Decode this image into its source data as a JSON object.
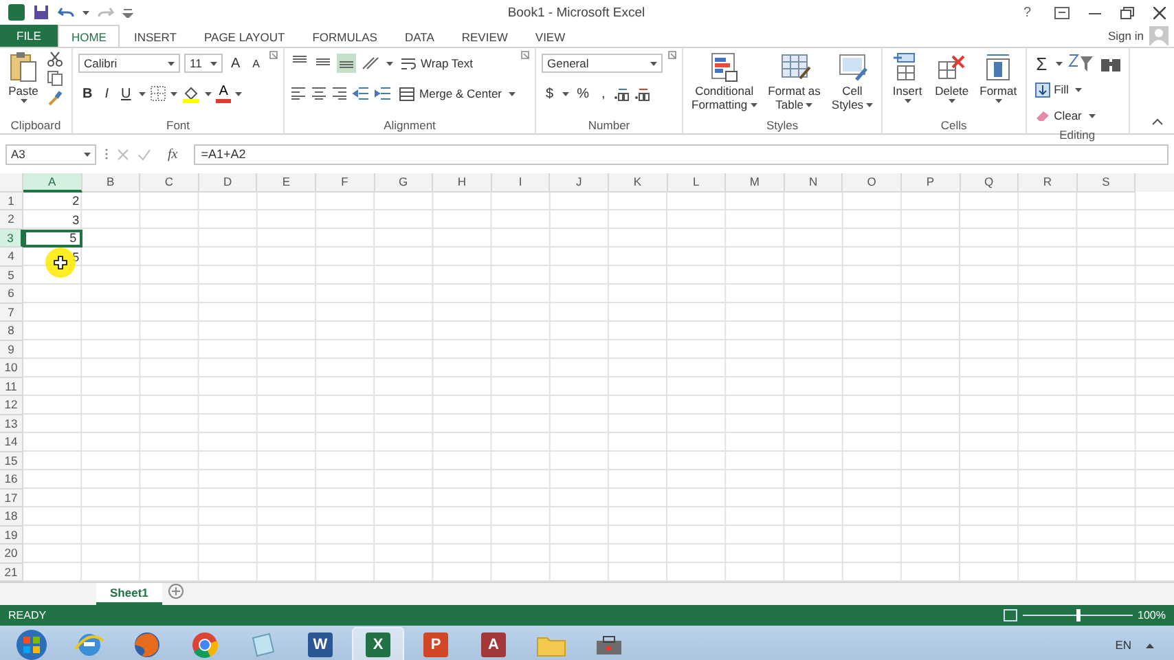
{
  "title_bar": {
    "title": "Book1 - Microsoft Excel",
    "help": "?"
  },
  "file_tab": {
    "label": "FILE"
  },
  "ribbon_tabs": [
    {
      "label": "HOME",
      "selected": true
    },
    {
      "label": "INSERT",
      "selected": false
    },
    {
      "label": "PAGE LAYOUT",
      "selected": false
    },
    {
      "label": "FORMULAS",
      "selected": false
    },
    {
      "label": "DATA",
      "selected": false
    },
    {
      "label": "REVIEW",
      "selected": false
    },
    {
      "label": "VIEW",
      "selected": false
    }
  ],
  "account": {
    "label": "Sign in"
  },
  "ribbon_groups": [
    {
      "kind": "clipboard",
      "label": "Clipboard",
      "paste": "Paste"
    },
    {
      "kind": "font",
      "label": "Font",
      "font": "Calibri",
      "size": "11",
      "grow": "A",
      "shrink": "A",
      "bold": "B",
      "italic": "I",
      "underline": "U",
      "font_color": "A"
    },
    {
      "kind": "alignment",
      "label": "Alignment",
      "vertical_align": [
        {
          "selected": false
        },
        {
          "selected": false
        },
        {
          "selected": true
        }
      ],
      "wrap": "Wrap Text",
      "merge": "Merge & Center"
    },
    {
      "kind": "number",
      "label": "Number",
      "format": "General",
      "currency": "$",
      "percent": "%",
      "comma": ","
    },
    {
      "kind": "styles",
      "label": "Styles",
      "buttons": [
        {
          "lines": [
            "Conditional",
            "Formatting"
          ]
        },
        {
          "lines": [
            "Format as",
            "Table"
          ]
        },
        {
          "lines": [
            "Cell",
            "Styles"
          ]
        }
      ]
    },
    {
      "kind": "cells",
      "label": "Cells",
      "buttons": [
        {
          "lines": [
            "Insert"
          ]
        },
        {
          "lines": [
            "Delete"
          ]
        },
        {
          "lines": [
            "Format"
          ]
        }
      ]
    },
    {
      "kind": "editing",
      "label": "Editing",
      "sum": "Σ",
      "fill": "Fill",
      "clear": "Clear"
    }
  ],
  "formula_bar": {
    "name_box": "A3",
    "function_label": "fx",
    "formula": "=A1+A2"
  },
  "sheet": {
    "columns": [
      {
        "label": "A",
        "selected": true
      },
      {
        "label": "B",
        "selected": false
      },
      {
        "label": "C",
        "selected": false
      },
      {
        "label": "D",
        "selected": false
      },
      {
        "label": "E",
        "selected": false
      },
      {
        "label": "F",
        "selected": false
      },
      {
        "label": "G",
        "selected": false
      },
      {
        "label": "H",
        "selected": false
      },
      {
        "label": "I",
        "selected": false
      },
      {
        "label": "J",
        "selected": false
      },
      {
        "label": "K",
        "selected": false
      },
      {
        "label": "L",
        "selected": false
      },
      {
        "label": "M",
        "selected": false
      },
      {
        "label": "N",
        "selected": false
      },
      {
        "label": "O",
        "selected": false
      },
      {
        "label": "P",
        "selected": false
      },
      {
        "label": "Q",
        "selected": false
      },
      {
        "label": "R",
        "selected": false
      },
      {
        "label": "S",
        "selected": false
      }
    ],
    "rows": [
      {
        "number": "1",
        "selected": false,
        "cells": [
          {
            "value": "2",
            "selected": false
          }
        ]
      },
      {
        "number": "2",
        "selected": false,
        "cells": [
          {
            "value": "3",
            "selected": false
          }
        ]
      },
      {
        "number": "3",
        "selected": true,
        "cells": [
          {
            "value": "5",
            "selected": true
          }
        ]
      },
      {
        "number": "4",
        "selected": false,
        "cells": [
          {
            "value": "5",
            "selected": false
          }
        ]
      },
      {
        "number": "5",
        "selected": false
      },
      {
        "number": "6",
        "selected": false
      },
      {
        "number": "7",
        "selected": false
      },
      {
        "number": "8",
        "selected": false
      },
      {
        "number": "9",
        "selected": false
      },
      {
        "number": "10",
        "selected": false
      },
      {
        "number": "11",
        "selected": false
      },
      {
        "number": "12",
        "selected": false
      },
      {
        "number": "13",
        "selected": false
      },
      {
        "number": "14",
        "selected": false
      },
      {
        "number": "15",
        "selected": false
      },
      {
        "number": "16",
        "selected": false
      },
      {
        "number": "17",
        "selected": false
      },
      {
        "number": "18",
        "selected": false
      },
      {
        "number": "19",
        "selected": false
      },
      {
        "number": "20",
        "selected": false
      },
      {
        "number": "21",
        "selected": false
      }
    ]
  },
  "sheet_tabs": [
    {
      "label": "Sheet1",
      "selected": true
    }
  ],
  "status_bar": {
    "mode": "READY",
    "zoom": "100%",
    "level": 0.5
  },
  "taskbar": {
    "apps": [
      {
        "kind": "start",
        "selected": false
      },
      {
        "kind": "browser-e",
        "selected": false
      },
      {
        "kind": "browser-fox",
        "selected": false
      },
      {
        "kind": "browser-chrome",
        "selected": false
      },
      {
        "kind": "notepad",
        "selected": false
      },
      {
        "kind": "office",
        "letter": "W",
        "color": "#2b5797",
        "selected": false
      },
      {
        "kind": "office",
        "letter": "X",
        "color": "#217346",
        "selected": true
      },
      {
        "kind": "office",
        "letter": "P",
        "color": "#d24726",
        "selected": false
      },
      {
        "kind": "office",
        "letter": "A",
        "color": "#a4373a",
        "selected": false
      },
      {
        "kind": "folder",
        "selected": false
      },
      {
        "kind": "tool",
        "selected": false
      }
    ],
    "language": "EN"
  }
}
